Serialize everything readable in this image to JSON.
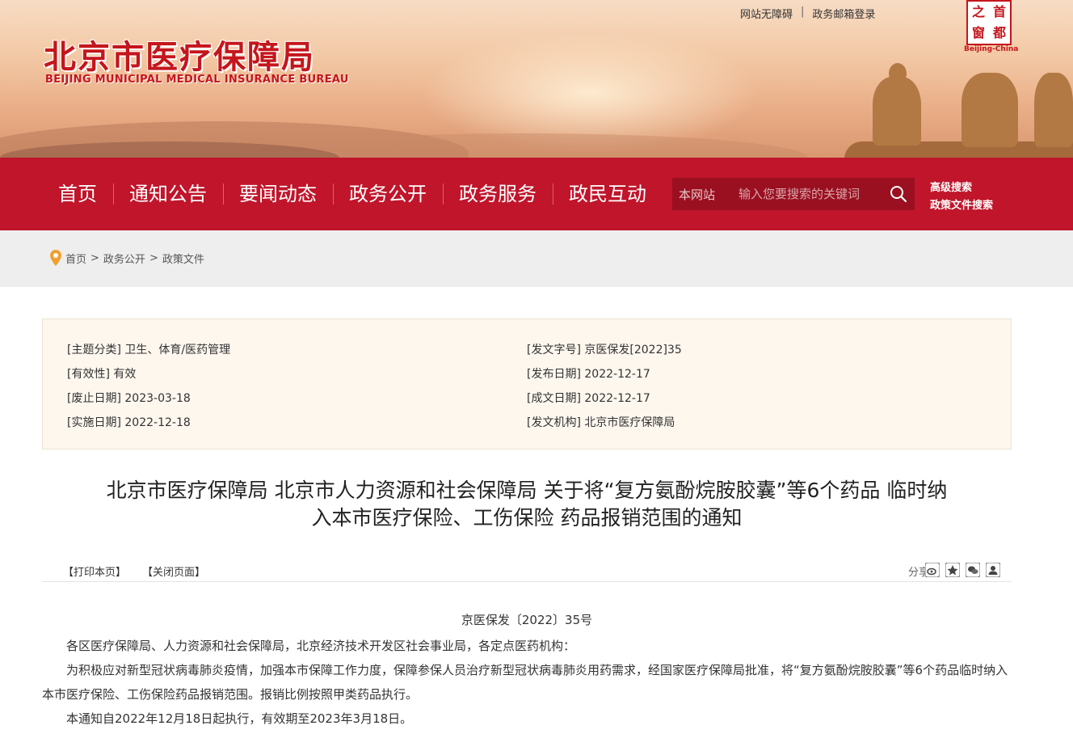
{
  "header": {
    "logo_cn": "北京市医疗保障局",
    "logo_en": "BEIJING MUNICIPAL MEDICAL INSURANCE BUREAU",
    "top_links": [
      "网站无障碍",
      "政务邮箱登录"
    ],
    "top_sep": "|",
    "seal_chars": [
      "之",
      "首",
      "窗",
      "都"
    ],
    "seal_en": "Beijing-China"
  },
  "nav": {
    "items": [
      "首页",
      "通知公告",
      "要闻动态",
      "政务公开",
      "政务服务",
      "政民互动"
    ],
    "search_scope": "本网站",
    "search_placeholder": "输入您要搜索的关键词",
    "advanced_search": "高级搜索",
    "policy_search": "政策文件搜索"
  },
  "breadcrumb": [
    "首页",
    "政务公开",
    "政策文件"
  ],
  "breadcrumb_sep": ">",
  "meta": {
    "left": [
      {
        "label": "[主题分类]",
        "value": "卫生、体育/医药管理"
      },
      {
        "label": "[有效性]",
        "value": "有效"
      },
      {
        "label": "[废止日期]",
        "value": "2023-03-18"
      },
      {
        "label": "[实施日期]",
        "value": "2022-12-18"
      }
    ],
    "right": [
      {
        "label": "[发文字号]",
        "value": "京医保发[2022]35"
      },
      {
        "label": "[发布日期]",
        "value": "2022-12-17"
      },
      {
        "label": "[成文日期]",
        "value": "2022-12-17"
      },
      {
        "label": "[发文机构]",
        "value": "北京市医疗保障局"
      }
    ]
  },
  "article": {
    "title_line1": "北京市医疗保障局 北京市人力资源和社会保障局 关于将“复方氨酚烷胺胶囊”等6个药品 临时纳",
    "title_line2": "入本市医疗保险、工伤保险 药品报销范围的通知",
    "print": "【打印本页】",
    "close": "【关闭页面】",
    "share": "分享",
    "doc_no": "京医保发〔2022〕35号",
    "recipients": "各区医疗保障局、人力资源和社会保障局，北京经济技术开发区社会事业局，各定点医药机构：",
    "para1": "为积极应对新型冠状病毒肺炎疫情，加强本市保障工作力度，保障参保人员治疗新型冠状病毒肺炎用药需求，经国家医疗保障局批准，将“复方氨酚烷胺胶囊”等6个药品临时纳入本市医疗保险、工伤保险药品报销范围。报销比例按照甲类药品执行。",
    "para2": "本通知自2022年12月18日起执行，有效期至2023年3月18日。"
  },
  "colors": {
    "brand_red": "#c0152b",
    "search_bg": "#9a1020",
    "meta_bg": "#fdf7ee",
    "crumb_bg": "#eeeeee"
  }
}
